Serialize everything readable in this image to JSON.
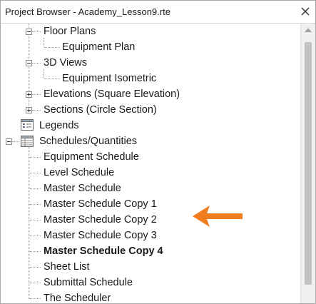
{
  "window": {
    "title": "Project Browser - Academy_Lesson9.rte"
  },
  "tree": {
    "items": [
      {
        "label": "Floor Plans",
        "expanded": true
      },
      {
        "label": "Equipment Plan"
      },
      {
        "label": "3D Views",
        "expanded": true
      },
      {
        "label": "Equipment Isometric"
      },
      {
        "label": "Elevations (Square Elevation)",
        "expanded": false
      },
      {
        "label": "Sections (Circle Section)",
        "expanded": false
      },
      {
        "label": "Legends"
      },
      {
        "label": "Schedules/Quantities",
        "expanded": true
      },
      {
        "label": "Equipment Schedule"
      },
      {
        "label": "Level Schedule"
      },
      {
        "label": "Master Schedule"
      },
      {
        "label": "Master Schedule Copy 1"
      },
      {
        "label": "Master Schedule Copy 2"
      },
      {
        "label": "Master Schedule Copy 3"
      },
      {
        "label": "Master Schedule Copy 4",
        "active": true
      },
      {
        "label": "Sheet List"
      },
      {
        "label": "Submittal Schedule"
      },
      {
        "label": "The Scheduler"
      }
    ]
  },
  "icons": {
    "close": "close-icon",
    "legends": "legend-view-icon",
    "schedules": "schedule-view-icon",
    "annotation": "arrow-left-icon"
  },
  "colors": {
    "annotation_arrow": "#f07d1e",
    "tree_lines": "#9a9a9a"
  }
}
